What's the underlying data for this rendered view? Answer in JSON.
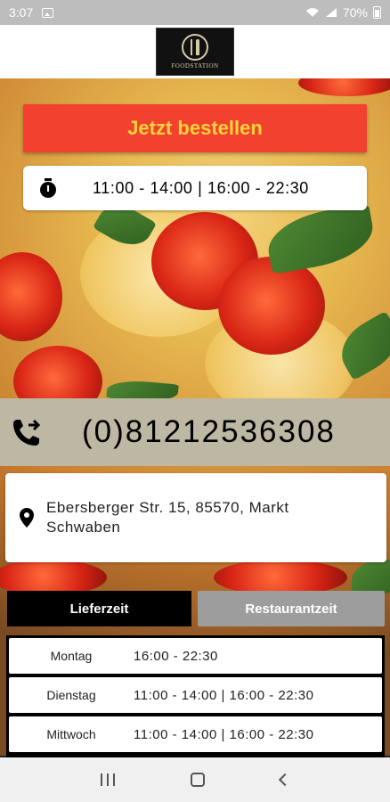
{
  "status_bar": {
    "time": "3:07",
    "battery": "70%"
  },
  "header": {
    "logo_text": "FOODSTATION"
  },
  "order_button": {
    "label": "Jetzt bestellen"
  },
  "opening_hours": {
    "text": "11:00 - 14:00 | 16:00 - 22:30"
  },
  "phone": {
    "number": "(0)81212536308"
  },
  "address": {
    "line1": "Ebersberger Str. 15, 85570, Markt",
    "line2": "Schwaben"
  },
  "tabs": [
    {
      "label": "Lieferzeit",
      "active": true
    },
    {
      "label": "Restaurantzeit",
      "active": false
    }
  ],
  "schedule": [
    {
      "day": "Montag",
      "time": "16:00 - 22:30"
    },
    {
      "day": "Dienstag",
      "time": "11:00 - 14:00 | 16:00 - 22:30"
    },
    {
      "day": "Mittwoch",
      "time": "11:00 - 14:00 | 16:00 - 22:30"
    }
  ],
  "colors": {
    "accent_red": "#f2412f",
    "accent_yellow": "#ffd43a",
    "phone_bar": "#bdb8a3",
    "tab_inactive": "#9d9d9d"
  },
  "icons": [
    "image-icon",
    "wifi-icon",
    "signal-icon",
    "battery-icon",
    "stopwatch-icon",
    "phone-forward-icon",
    "location-pin-icon",
    "recent-apps-icon",
    "home-icon",
    "back-icon"
  ]
}
